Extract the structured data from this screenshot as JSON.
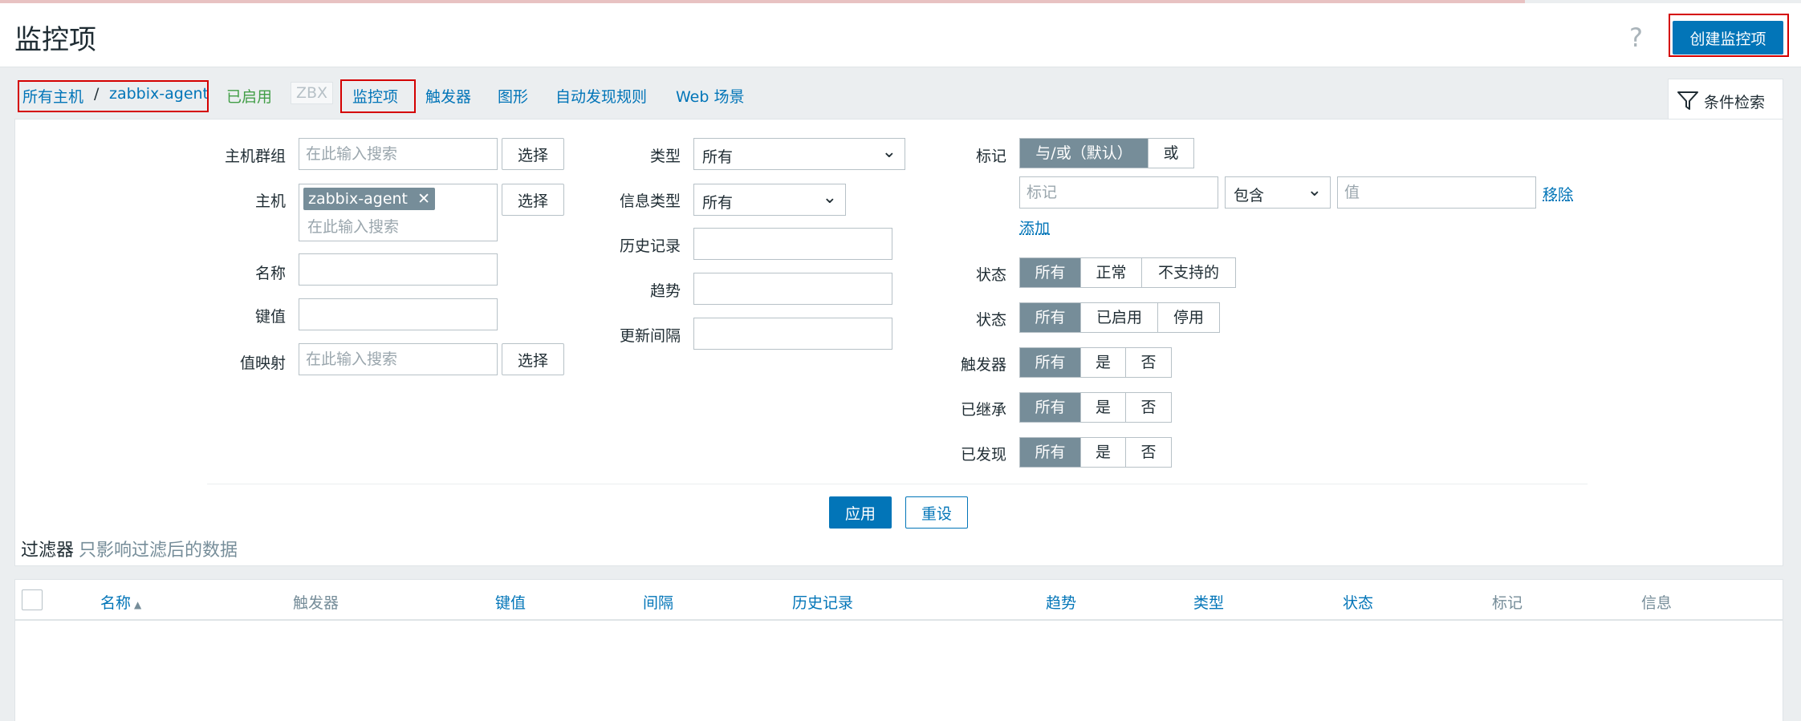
{
  "header": {
    "title": "监控项",
    "help": "?",
    "create_button": "创建监控项"
  },
  "nav": {
    "breadcrumb": [
      "所有主机",
      "zabbix-agent"
    ],
    "separator": "/",
    "enabled": "已启用",
    "zbx": "ZBX",
    "tabs": [
      "监控项",
      "触发器",
      "图形",
      "自动发现规则",
      "Web 场景"
    ],
    "filter_tab": "条件检索"
  },
  "filter": {
    "col1": {
      "host_group_label": "主机群组",
      "host_group_placeholder": "在此输入搜索",
      "host_label": "主机",
      "host_chip": "zabbix-agent",
      "host_placeholder": "在此输入搜索",
      "name_label": "名称",
      "key_label": "键值",
      "valuemap_label": "值映射",
      "valuemap_placeholder": "在此输入搜索",
      "select_button": "选择"
    },
    "col2": {
      "type_label": "类型",
      "type_value": "所有",
      "info_type_label": "信息类型",
      "info_type_value": "所有",
      "history_label": "历史记录",
      "trends_label": "趋势",
      "interval_label": "更新间隔"
    },
    "col3": {
      "tags_label": "标记",
      "tag_ops": [
        "与/或（默认）",
        "或"
      ],
      "tag_placeholder": "标记",
      "tag_operator": "包含",
      "value_placeholder": "值",
      "remove": "移除",
      "add": "添加",
      "state_label": "状态",
      "state_options": [
        "所有",
        "正常",
        "不支持的"
      ],
      "status_label": "状态",
      "status_options": [
        "所有",
        "已启用",
        "停用"
      ],
      "triggers_label": "触发器",
      "triggers_options": [
        "所有",
        "是",
        "否"
      ],
      "inherited_label": "已继承",
      "inherited_options": [
        "所有",
        "是",
        "否"
      ],
      "discovered_label": "已发现",
      "discovered_options": [
        "所有",
        "是",
        "否"
      ]
    },
    "apply": "应用",
    "reset": "重设",
    "note_title": "过滤器",
    "note_sub": "只影响过滤后的数据"
  },
  "table": {
    "columns": [
      "名称",
      "触发器",
      "键值",
      "间隔",
      "历史记录",
      "趋势",
      "类型",
      "状态",
      "标记",
      "信息"
    ],
    "sort_indicator": "▲"
  }
}
